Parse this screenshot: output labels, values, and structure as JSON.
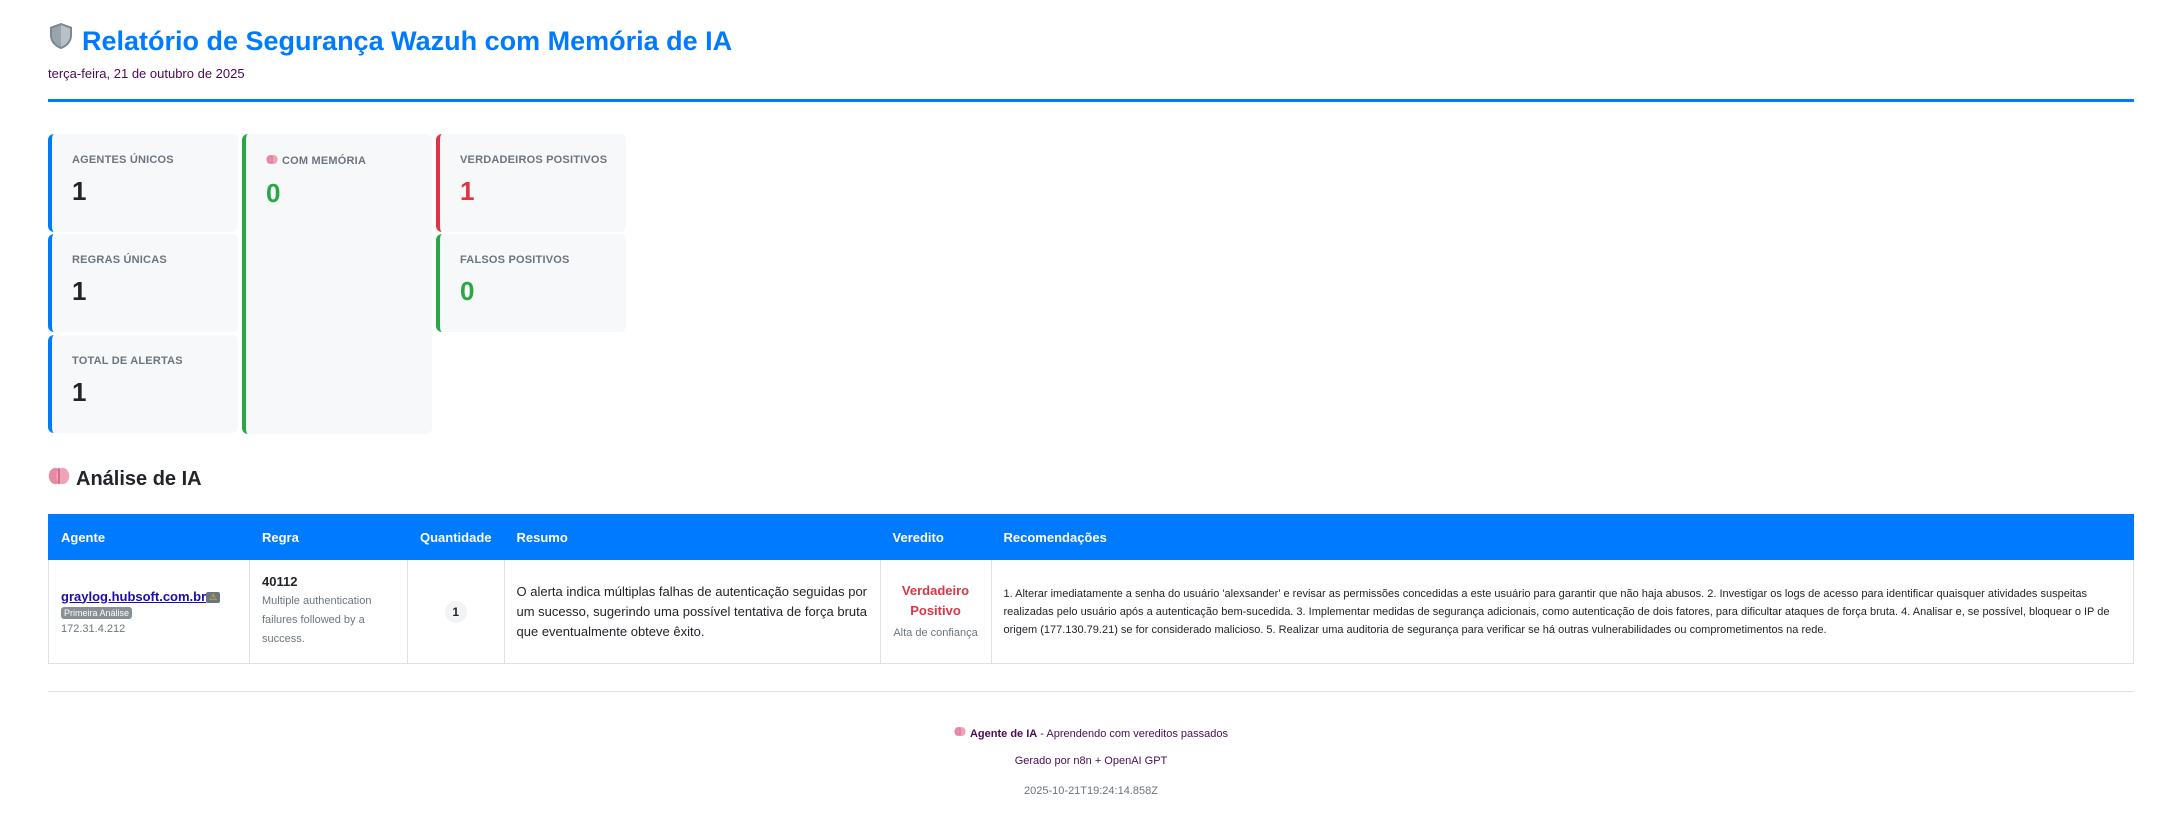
{
  "header": {
    "title": "Relatório de Segurança Wazuh com Memória de IA",
    "date": "terça-feira, 21 de outubro de 2025"
  },
  "stats": {
    "unique_agents_label": "Agentes Únicos",
    "unique_agents_value": "1",
    "with_memory_label": "Com Memória",
    "with_memory_value": "0",
    "true_positives_label": "Verdadeiros Positivos",
    "true_positives_value": "1",
    "unique_rules_label": "Regras Únicas",
    "unique_rules_value": "1",
    "false_positives_label": "Falsos Positivos",
    "false_positives_value": "0",
    "total_alerts_label": "Total de Alertas",
    "total_alerts_value": "1"
  },
  "analysis": {
    "title": "Análise de IA",
    "columns": [
      "Agente",
      "Regra",
      "Quantidade",
      "Resumo",
      "Veredito",
      "Recomendações"
    ],
    "rows": [
      {
        "agent": "graylog.hubsoft.com.br",
        "badge": "Primeira Análise",
        "ip": "172.31.4.212",
        "rule_id": "40112",
        "rule_desc": "Multiple authentication failures followed by a success.",
        "quantity": "1",
        "summary": "O alerta indica múltiplas falhas de autenticação seguidas por um sucesso, sugerindo uma possível tentativa de força bruta que eventualmente obteve êxito.",
        "verdict": "Verdadeiro Positivo",
        "confidence": "Alta de confiança",
        "recommendations": "1. Alterar imediatamente a senha do usuário 'alexsander' e revisar as permissões concedidas a este usuário para garantir que não haja abusos. 2. Investigar os logs de acesso para identificar quaisquer atividades suspeitas realizadas pelo usuário após a autenticação bem-sucedida. 3. Implementar medidas de segurança adicionais, como autenticação de dois fatores, para dificultar ataques de força bruta. 4. Analisar e, se possível, bloquear o IP de origem (177.130.79.21) se for considerado malicioso. 5. Realizar uma auditoria de segurança para verificar se há outras vulnerabilidades ou comprometimentos na rede."
      }
    ]
  },
  "footer": {
    "agent_label": "Agente de IA",
    "agent_text": " - Aprendendo com vereditos passados",
    "generated_by": "Gerado por n8n + OpenAI GPT",
    "timestamp": "2025-10-21T19:24:14.858Z"
  },
  "colors": {
    "primary": "#007bff",
    "success": "#28a745",
    "danger": "#dc3545"
  },
  "icons": [
    "shield-icon",
    "brain-icon",
    "warning-icon"
  ]
}
